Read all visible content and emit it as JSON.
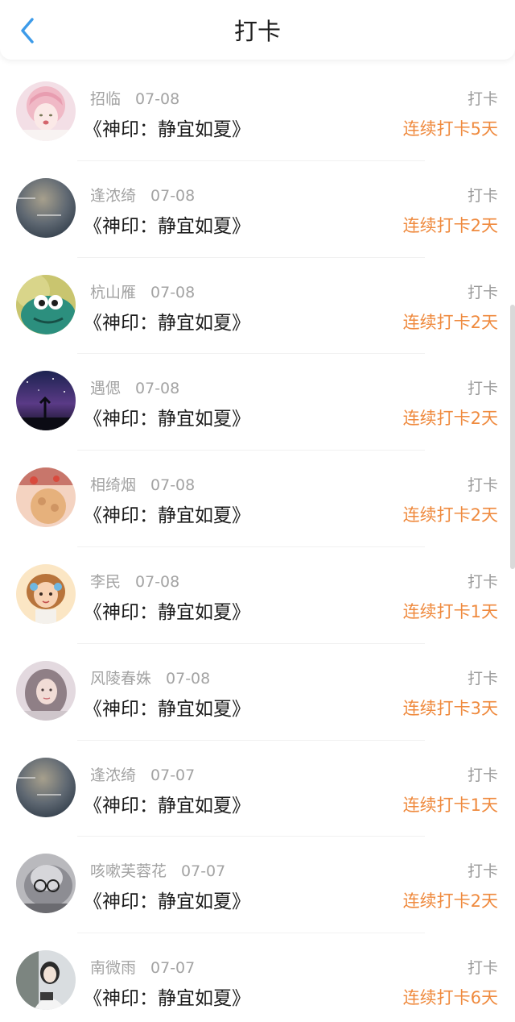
{
  "header": {
    "title": "打卡",
    "back_icon": "chevron-left-icon",
    "back_color": "#3d9be9"
  },
  "colors": {
    "streak": "#ef8a3e",
    "meta": "#a3a3a3"
  },
  "entries": [
    {
      "name": "招临",
      "date": "07-08",
      "book": "《神印：静宜如夏》",
      "action": "打卡",
      "streak": "连续打卡5天"
    },
    {
      "name": "逢浓绮",
      "date": "07-08",
      "book": "《神印：静宜如夏》",
      "action": "打卡",
      "streak": "连续打卡2天"
    },
    {
      "name": "杭山雁",
      "date": "07-08",
      "book": "《神印：静宜如夏》",
      "action": "打卡",
      "streak": "连续打卡2天"
    },
    {
      "name": "遇偲",
      "date": "07-08",
      "book": "《神印：静宜如夏》",
      "action": "打卡",
      "streak": "连续打卡2天"
    },
    {
      "name": "相绮烟",
      "date": "07-08",
      "book": "《神印：静宜如夏》",
      "action": "打卡",
      "streak": "连续打卡2天"
    },
    {
      "name": "李民",
      "date": "07-08",
      "book": "《神印：静宜如夏》",
      "action": "打卡",
      "streak": "连续打卡1天"
    },
    {
      "name": "风陵春姝",
      "date": "07-08",
      "book": "《神印：静宜如夏》",
      "action": "打卡",
      "streak": "连续打卡3天"
    },
    {
      "name": "逢浓绮",
      "date": "07-07",
      "book": "《神印：静宜如夏》",
      "action": "打卡",
      "streak": "连续打卡1天"
    },
    {
      "name": "咳嗽芙蓉花",
      "date": "07-07",
      "book": "《神印：静宜如夏》",
      "action": "打卡",
      "streak": "连续打卡2天"
    },
    {
      "name": "南微雨",
      "date": "07-07",
      "book": "《神印：静宜如夏》",
      "action": "打卡",
      "streak": "连续打卡6天"
    }
  ]
}
